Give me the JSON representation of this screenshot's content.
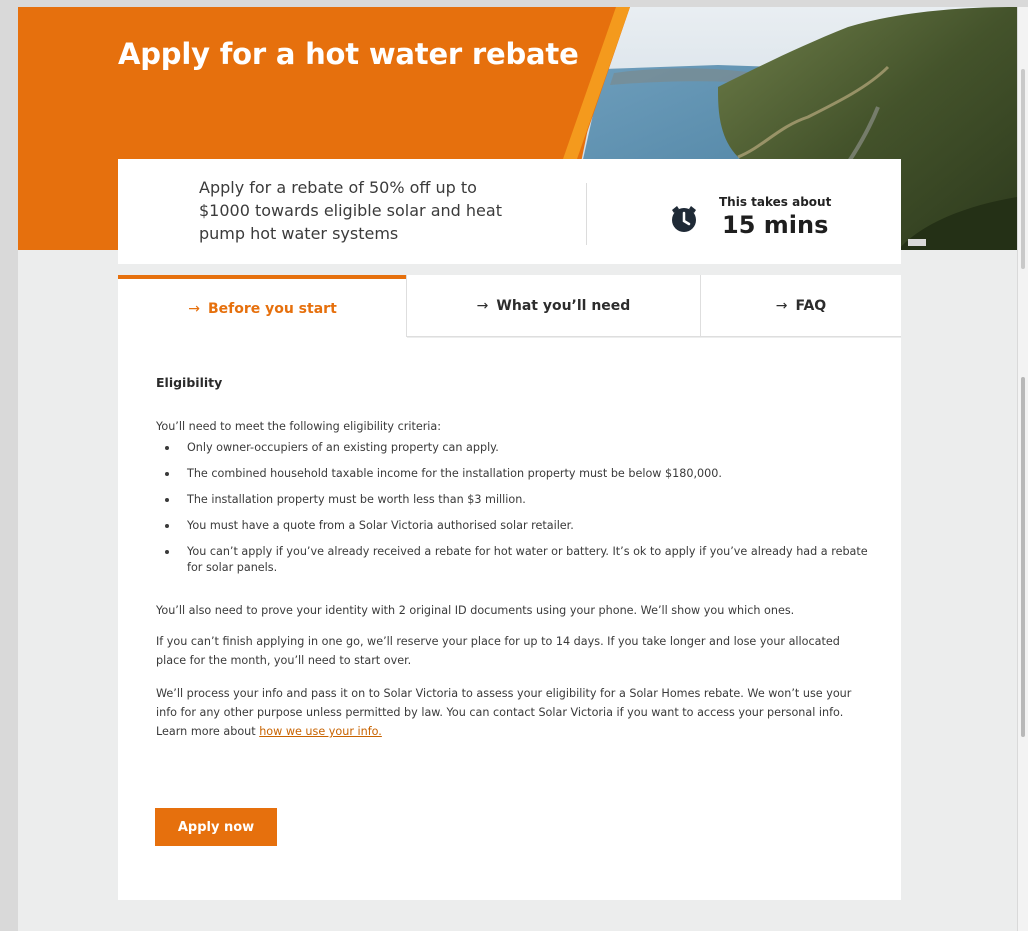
{
  "hero": {
    "title": "Apply for a hot water rebate",
    "summary": "Apply for a rebate of 50% off up to $1000 towards eligible solar and heat pump hot water systems",
    "time_label": "This takes about",
    "time_value": "15 mins",
    "time_icon": "alarm-clock-icon"
  },
  "tabs": [
    {
      "label": "Before you start",
      "icon": "arrow-right-icon",
      "active": true
    },
    {
      "label": "What you’ll need",
      "icon": "arrow-right-icon",
      "active": false
    },
    {
      "label": "FAQ",
      "icon": "arrow-right-icon",
      "active": false
    }
  ],
  "content": {
    "heading": "Eligibility",
    "intro": "You’ll need to meet the following eligibility criteria:",
    "criteria": [
      "Only owner-occupiers of an existing property can apply.",
      "The combined household taxable income for the installation property must be below $180,000.",
      "The installation property must be worth less than $3 million.",
      "You must have a quote from a Solar Victoria authorised solar retailer.",
      "You can’t apply if you’ve already received a rebate for hot water or battery. It’s ok to apply if you’ve already had a rebate for solar panels."
    ],
    "identity": "You’ll also need to prove your identity with 2 original ID documents using your phone. We’ll show you which ones.",
    "reserve": "If you can’t finish applying in one go, we’ll reserve your place for up to 14 days. If you take longer and lose your allocated place for the month, you’ll need to start over.",
    "privacy": "We’ll process your info and pass it on to Solar Victoria to assess your eligibility for a Solar Homes rebate. We won’t use your info for any other purpose unless permitted by law. You can contact Solar Victoria if you want to access your personal info. Learn more about ",
    "privacy_link": "how we use your info.",
    "apply_button": "Apply now"
  },
  "colors": {
    "brand_orange": "#e6700d",
    "background": "#eceded"
  }
}
